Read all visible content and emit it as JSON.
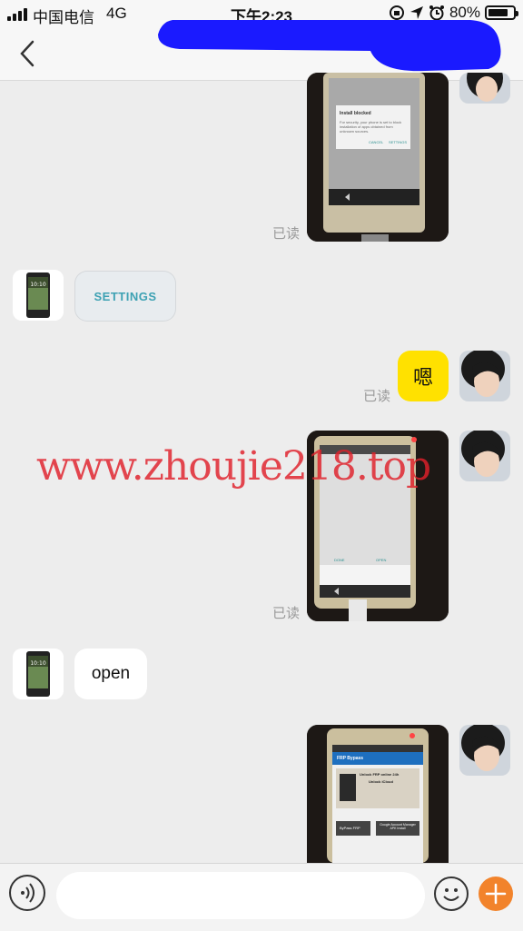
{
  "status_bar": {
    "carrier": "中国电信",
    "network": "4G",
    "time": "下午2:23",
    "battery_percent": "80%",
    "battery_level": 0.8
  },
  "nav": {
    "back_icon": "chevron-left-icon",
    "title_redacted_color": "#1a1aff"
  },
  "messages": [
    {
      "side": "right",
      "type": "photo",
      "content": "phone-screen-install-blocked",
      "status": "已读"
    },
    {
      "side": "left",
      "type": "image",
      "content": "SETTINGS"
    },
    {
      "side": "right",
      "type": "text",
      "content": "嗯",
      "status": "已读"
    },
    {
      "side": "right",
      "type": "photo",
      "content": "phone-screen-dialog",
      "status": "已读"
    },
    {
      "side": "left",
      "type": "text",
      "content": "open"
    },
    {
      "side": "right",
      "type": "photo",
      "content": "phone-screen-frp-bypass"
    }
  ],
  "photo_texts": {
    "dialog_title": "Install blocked",
    "dialog_body": "For security, your phone is set to block installation of apps obtained from unknown sources.",
    "dialog_cancel": "CANCEL",
    "dialog_settings": "SETTINGS",
    "dialog2_done": "DONE",
    "dialog2_open": "OPEN",
    "frp_title": "FRP Bypass",
    "frp_banner_1": "Unlock FRP online 24h",
    "frp_banner_2": "Unlock iCloud",
    "frp_btn_1": "ByPass FRP",
    "frp_btn_2": "Google Account Manager APK Install"
  },
  "watermark": "www.zhoujie218.top",
  "colors": {
    "accent_yellow": "#ffe100",
    "plus_orange": "#f2832b",
    "watermark_red": "#e0202a"
  },
  "input_bar": {
    "voice_icon": "voice-icon",
    "emoji_icon": "emoji-icon",
    "plus_icon": "plus-icon"
  }
}
